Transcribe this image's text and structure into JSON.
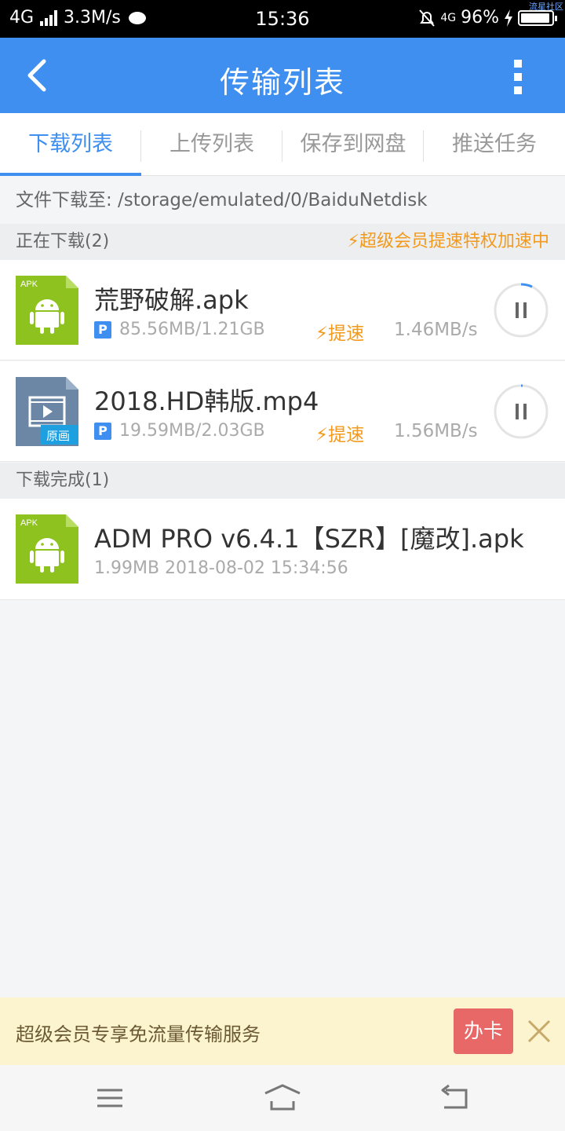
{
  "status_bar": {
    "network": "4G",
    "speed": "3.3M/s",
    "time": "15:36",
    "network2": "4G",
    "battery": "96%",
    "watermark": "流星社区"
  },
  "header": {
    "title": "传输列表"
  },
  "tabs": [
    {
      "label": "下载列表",
      "active": true
    },
    {
      "label": "上传列表",
      "active": false
    },
    {
      "label": "保存到网盘",
      "active": false
    },
    {
      "label": "推送任务",
      "active": false
    }
  ],
  "path": {
    "text": "文件下载至: /storage/emulated/0/BaiduNetdisk"
  },
  "downloading": {
    "label": "正在下载(2)",
    "promo": "⚡超级会员提速特权加速中",
    "items": [
      {
        "icon": "apk-file-icon",
        "icon_label": "APK",
        "name": "荒野破解.apk",
        "badge": "P",
        "size": "85.56MB/1.21GB",
        "boost": "⚡提速",
        "speed": "1.46MB/s",
        "progress": 0.07
      },
      {
        "icon": "video-file-icon",
        "icon_label": "原画",
        "name": "2018.HD韩版.mp4",
        "badge": "P",
        "size": "19.59MB/2.03GB",
        "boost": "⚡提速",
        "speed": "1.56MB/s",
        "progress": 0.01
      }
    ]
  },
  "completed": {
    "label": "下载完成(1)",
    "items": [
      {
        "icon": "apk-file-icon",
        "icon_label": "APK",
        "name": "ADM PRO v6.4.1【SZR】[魔改].apk",
        "meta": "1.99MB 2018-08-02 15:34:56"
      }
    ]
  },
  "promo_bar": {
    "text": "超级会员专享免流量传输服务",
    "button": "办卡"
  },
  "colors": {
    "primary": "#3e8ff0",
    "accent": "#f39a1c",
    "apk_green": "#8dc21f",
    "video_gray": "#6c87a6",
    "card_button": "#e86868"
  }
}
